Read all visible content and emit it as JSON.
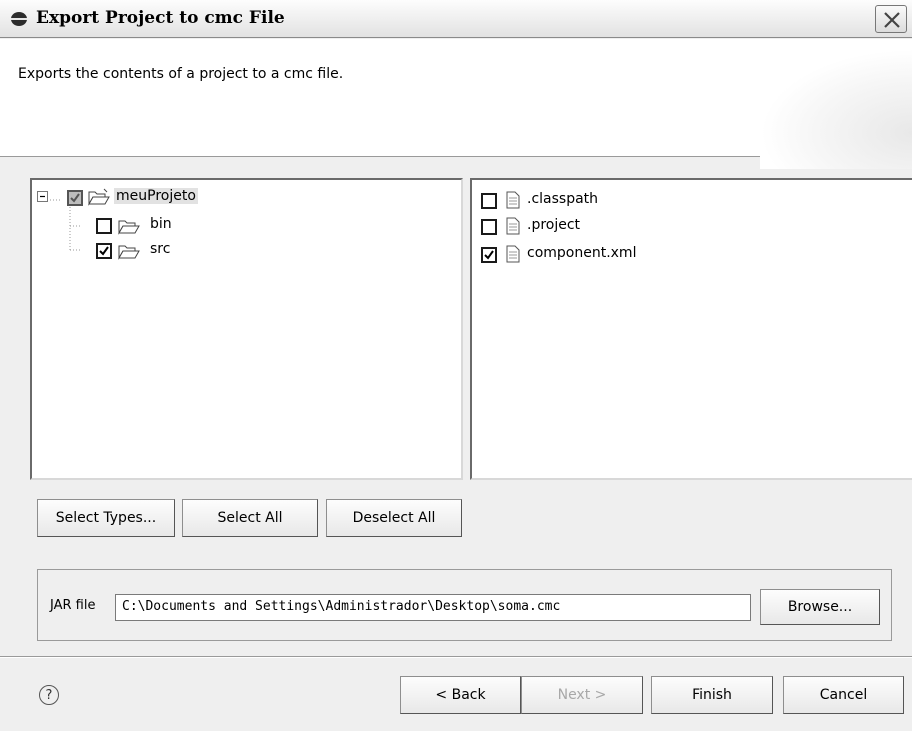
{
  "window": {
    "title": "Export Project to cmc File",
    "close_icon": "close-icon"
  },
  "header": {
    "description": "Exports the contents of a project to a cmc file."
  },
  "tree": {
    "root": {
      "label": "meuProjeto",
      "state": "partial",
      "expanded": true
    },
    "children": [
      {
        "label": "bin",
        "checked": false
      },
      {
        "label": "src",
        "checked": true
      }
    ]
  },
  "files": [
    {
      "label": ".classpath",
      "checked": false
    },
    {
      "label": ".project",
      "checked": false
    },
    {
      "label": "component.xml",
      "checked": true
    }
  ],
  "selection_buttons": {
    "select_types": "Select Types...",
    "select_all": "Select All",
    "deselect_all": "Deselect All"
  },
  "jar": {
    "label": "JAR file",
    "value": "C:\\Documents and Settings\\Administrador\\Desktop\\soma.cmc",
    "browse": "Browse..."
  },
  "footer": {
    "help_icon": "?",
    "back": "< Back",
    "next": "Next >",
    "next_enabled": false,
    "finish": "Finish",
    "cancel": "Cancel"
  }
}
